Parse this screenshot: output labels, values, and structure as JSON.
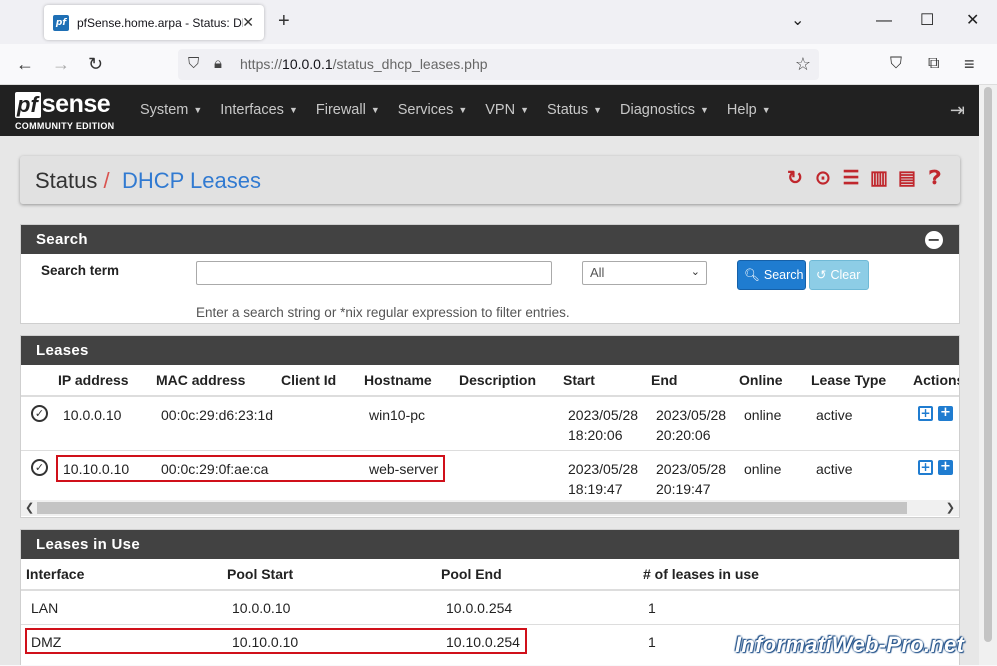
{
  "browser": {
    "tab_title": "pfSense.home.arpa - Status: DHCP Leases",
    "favicon_text": "pf",
    "url_prefix": "https://",
    "url_host": "10.0.0.1",
    "url_path": "/status_dhcp_leases.php"
  },
  "brand": {
    "pf": "pf",
    "sense": "sense",
    "edition": "COMMUNITY EDITION"
  },
  "menu": [
    "System",
    "Interfaces",
    "Firewall",
    "Services",
    "VPN",
    "Status",
    "Diagnostics",
    "Help"
  ],
  "breadcrumb": {
    "section": "Status",
    "separator": "/",
    "page": "DHCP Leases"
  },
  "search": {
    "header": "Search",
    "label": "Search term",
    "input_value": "",
    "select_value": "All",
    "search_button": "Search",
    "clear_button": "Clear",
    "help": "Enter a search string or *nix regular expression to filter entries."
  },
  "leases": {
    "header": "Leases",
    "columns": [
      "IP address",
      "MAC address",
      "Client Id",
      "Hostname",
      "Description",
      "Start",
      "End",
      "Online",
      "Lease Type",
      "Actions"
    ],
    "rows": [
      {
        "ip": "10.0.0.10",
        "mac": "00:0c:29:d6:23:1d",
        "client_id": "",
        "hostname": "win10-pc",
        "description": "",
        "start_date": "2023/05/28",
        "start_time": "18:20:06",
        "end_date": "2023/05/28",
        "end_time": "20:20:06",
        "online": "online",
        "type": "active"
      },
      {
        "ip": "10.10.0.10",
        "mac": "00:0c:29:0f:ae:ca",
        "client_id": "",
        "hostname": "web-server",
        "description": "",
        "start_date": "2023/05/28",
        "start_time": "18:19:47",
        "end_date": "2023/05/28",
        "end_time": "20:19:47",
        "online": "online",
        "type": "active"
      }
    ]
  },
  "in_use": {
    "header": "Leases in Use",
    "columns": [
      "Interface",
      "Pool Start",
      "Pool End",
      "# of leases in use"
    ],
    "rows": [
      {
        "iface": "LAN",
        "start": "10.0.0.10",
        "end": "10.0.0.254",
        "count": "1"
      },
      {
        "iface": "DMZ",
        "start": "10.10.0.10",
        "end": "10.10.0.254",
        "count": "1"
      }
    ]
  },
  "watermark": "InformatiWeb-Pro.net",
  "colors": {
    "accent_red": "#c0272d",
    "link_blue": "#317ad1",
    "header_dark": "#424242",
    "highlight": "#d0101a"
  }
}
